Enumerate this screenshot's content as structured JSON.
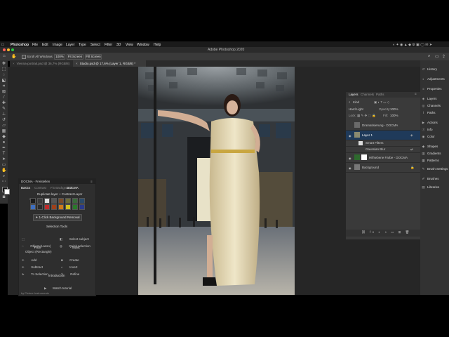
{
  "menubar": {
    "app": "Photoshop",
    "items": [
      "File",
      "Edit",
      "Image",
      "Layer",
      "Type",
      "Select",
      "Filter",
      "3D",
      "View",
      "Window",
      "Help"
    ]
  },
  "title": "Adobe Photoshop 2020",
  "options": {
    "scroll_all": "Scroll All Windows",
    "zoom": "100%",
    "fit_screen": "Fit Screen",
    "fill_screen": "Fill Screen"
  },
  "tabs": [
    {
      "label": "Vienna-portrait.psd @ 36,7% (RGB/8)"
    },
    {
      "label": "Studio.psd @ 17,6% (Layer 1, RGB/8) *"
    }
  ],
  "layers_panel": {
    "tabs": [
      "Layers",
      "Channels",
      "Paths"
    ],
    "kind": "Kind",
    "blend_mode": "Hard Light",
    "opacity_label": "Opacity:",
    "opacity": "100%",
    "lock_label": "Lock:",
    "fill_label": "Fill:",
    "fill": "100%",
    "layers": [
      {
        "name": "Dramatisierung - DOCMA"
      },
      {
        "name": "Layer 1"
      },
      {
        "name": "Smart Filters"
      },
      {
        "name": "Gaussian Blur"
      },
      {
        "name": "Hilfsebene Farbe - DOCMA"
      },
      {
        "name": "Background"
      }
    ]
  },
  "right_dock": [
    {
      "label": "History",
      "icon": "history-icon"
    },
    {
      "label": "Adjustments",
      "icon": "adjustments-icon"
    },
    {
      "label": "Properties",
      "icon": "properties-icon"
    },
    {
      "label": "Layers",
      "icon": "layers-icon"
    },
    {
      "label": "Channels",
      "icon": "channels-icon"
    },
    {
      "label": "Paths",
      "icon": "paths-icon"
    },
    {
      "label": "Actions",
      "icon": "actions-icon"
    },
    {
      "label": "Info",
      "icon": "info-icon"
    },
    {
      "label": "Color",
      "icon": "color-icon"
    },
    {
      "label": "Shapes",
      "icon": "shapes-icon"
    },
    {
      "label": "Gradients",
      "icon": "gradients-icon"
    },
    {
      "label": "Patterns",
      "icon": "patterns-icon"
    },
    {
      "label": "Brush Settings",
      "icon": "brush-settings-icon"
    },
    {
      "label": "Brushes",
      "icon": "brushes-icon"
    },
    {
      "label": "Libraries",
      "icon": "libraries-icon"
    }
  ],
  "plugin": {
    "title": "DOCMA - Freistellen",
    "tabs": [
      "Basics",
      "Contrast",
      "Fix Background",
      "DOCMA"
    ],
    "dup_label": "Duplicate layer + Contrast Layer",
    "one_click": "1-Click Background Removal",
    "selection_tools": "Selection Tools",
    "obj_rect": "Object (Rectangle)",
    "select_subject": "Select subject",
    "obj_lasso": "Object (Lasso)",
    "quick_selection": "Quick selection",
    "path_heading": "Path",
    "mask_heading": "Mask",
    "path_add": "Add",
    "path_subtract": "Subtract",
    "path_to_selection": "To Selection",
    "mask_create": "Create",
    "mask_invert": "Invert",
    "mask_refine": "Refine",
    "introduction": "Introduction",
    "watch_tutorial": "Watch tutorial",
    "footer": "by Picture Instruments",
    "swatch_colors": [
      "#1a1a1a",
      "#3a3a3a",
      "#e0e0e0",
      "#555555",
      "#7a4a2a",
      "#6a6a3a",
      "#3a6a3a",
      "#2a4a6a",
      "#3f6fbf",
      "#2a2a2a",
      "#c02a2a",
      "#a0401a",
      "#d07a1a",
      "#d0c020",
      "#2a7a2a",
      "#2a3a8a"
    ]
  }
}
